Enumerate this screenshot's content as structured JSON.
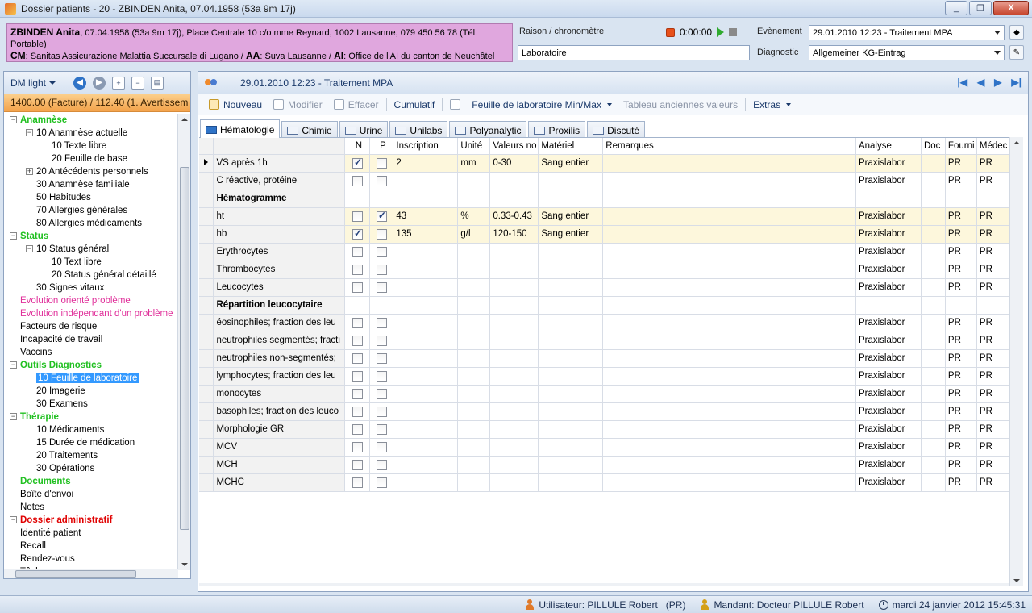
{
  "window": {
    "title": "Dossier patients - 20 - ZBINDEN Anita, 07.04.1958 (53a 9m 17j)",
    "controls": [
      "_",
      "❐",
      "X"
    ]
  },
  "patient": {
    "name": "ZBINDEN Anita",
    "details": ", 07.04.1958 (53a 9m 17j), Place Centrale 10 c/o mme Reynard, 1002 Lausanne, 079 450 56 78 (Tél. Portable)",
    "cm_label": "CM",
    "cm_value": ": Sanitas Assicurazione Malattia Succursale di Lugano / ",
    "aa_label": "AA",
    "aa_value": ": Suva Lausanne / ",
    "ai_label": "AI",
    "ai_value": ": Office de l'AI du canton de Neuchâtel"
  },
  "header": {
    "raison_label": "Raison / chronomètre",
    "raison_value": "Laboratoire",
    "timer": "0:00:00",
    "evenement_label": "Evènement",
    "evenement_value": "29.01.2010 12:23 - Traitement MPA",
    "diagnostic_label": "Diagnostic",
    "diagnostic_value": "Allgemeiner KG-Eintrag"
  },
  "left": {
    "view_selector": "DM light",
    "facture": "1400.00 (Facture) / 112.40 (1. Avertissem",
    "tree": [
      {
        "label": "Anamnèse",
        "level": 0,
        "style": "green",
        "exp": "−"
      },
      {
        "label": "10 Anamnèse actuelle",
        "level": 1,
        "exp": "−"
      },
      {
        "label": "10 Texte libre",
        "level": 2
      },
      {
        "label": "20 Feuille de base",
        "level": 2
      },
      {
        "label": "20 Antécédents personnels",
        "level": 1,
        "exp": "+"
      },
      {
        "label": "30 Anamnèse familiale",
        "level": 1
      },
      {
        "label": "50 Habitudes",
        "level": 1
      },
      {
        "label": "70 Allergies générales",
        "level": 1
      },
      {
        "label": "80 Allergies médicaments",
        "level": 1
      },
      {
        "label": "Status",
        "level": 0,
        "style": "green",
        "exp": "−"
      },
      {
        "label": "10 Status général",
        "level": 1,
        "exp": "−"
      },
      {
        "label": "10 Text libre",
        "level": 2
      },
      {
        "label": "20 Status général détaillé",
        "level": 2
      },
      {
        "label": "30 Signes vitaux",
        "level": 1
      },
      {
        "label": "Evolution orienté problème",
        "level": 0,
        "style": "pink"
      },
      {
        "label": "Evolution indépendant d'un problème",
        "level": 0,
        "style": "pink"
      },
      {
        "label": "Facteurs de risque",
        "level": 0
      },
      {
        "label": "Incapacité de travail",
        "level": 0
      },
      {
        "label": "Vaccins",
        "level": 0
      },
      {
        "label": "Outils Diagnostics",
        "level": 0,
        "style": "green",
        "exp": "−"
      },
      {
        "label": "10 Feuille de laboratoire",
        "level": 1,
        "selected": true
      },
      {
        "label": "20 Imagerie",
        "level": 1
      },
      {
        "label": "30 Examens",
        "level": 1
      },
      {
        "label": "Thérapie",
        "level": 0,
        "style": "green",
        "exp": "−"
      },
      {
        "label": "10 Médicaments",
        "level": 1
      },
      {
        "label": "15 Durée de médication",
        "level": 1
      },
      {
        "label": "20 Traitements",
        "level": 1
      },
      {
        "label": "30 Opérations",
        "level": 1
      },
      {
        "label": "Documents",
        "level": 0,
        "style": "green"
      },
      {
        "label": "Boîte d'envoi",
        "level": 0
      },
      {
        "label": "Notes",
        "level": 0
      },
      {
        "label": "Dossier administratif",
        "level": 0,
        "style": "red",
        "exp": "−"
      },
      {
        "label": "Identité patient",
        "level": 0
      },
      {
        "label": "Recall",
        "level": 0
      },
      {
        "label": "Rendez-vous",
        "level": 0
      },
      {
        "label": "Tâches",
        "level": 0
      }
    ]
  },
  "main": {
    "event_title": "29.01.2010 12:23 - Traitement MPA",
    "pager": [
      "|◀",
      "◀",
      "▶",
      "▶|"
    ],
    "toolbar": {
      "nouveau": "Nouveau",
      "modifier": "Modifier",
      "effacer": "Effacer",
      "cumulatif": "Cumulatif",
      "feuille": "Feuille de laboratoire Min/Max",
      "tableau": "Tableau anciennes valeurs",
      "extras": "Extras"
    },
    "tabs": [
      "Hématologie",
      "Chimie",
      "Urine",
      "Unilabs",
      "Polyanalytic",
      "Proxilis",
      "Discuté"
    ],
    "columns": [
      "",
      "",
      "N",
      "P",
      "Inscription",
      "Unité",
      "Valeurs no",
      "Matériel",
      "Remarques",
      "Analyse",
      "Doc",
      "Fourni",
      "Médec"
    ],
    "rows": [
      {
        "name": "VS après 1h",
        "n": true,
        "p": false,
        "inscription": "2",
        "unite": "mm",
        "valeurs": "0-30",
        "materiel": "Sang entier",
        "analyse": "Praxislabor",
        "fourni": "PR",
        "medec": "PR",
        "filled": true,
        "current": true
      },
      {
        "name": "C réactive, protéine",
        "n": false,
        "p": false,
        "analyse": "Praxislabor",
        "fourni": "PR",
        "medec": "PR"
      },
      {
        "name": "Hématogramme",
        "group": true
      },
      {
        "name": "ht",
        "n": false,
        "p": true,
        "inscription": "43",
        "unite": "%",
        "valeurs": "0.33-0.43",
        "materiel": "Sang entier",
        "analyse": "Praxislabor",
        "fourni": "PR",
        "medec": "PR",
        "filled": true
      },
      {
        "name": "hb",
        "n": true,
        "p": false,
        "inscription": "135",
        "unite": "g/l",
        "valeurs": "120-150",
        "materiel": "Sang entier",
        "analyse": "Praxislabor",
        "fourni": "PR",
        "medec": "PR",
        "filled": true
      },
      {
        "name": "Erythrocytes",
        "n": false,
        "p": false,
        "analyse": "Praxislabor",
        "fourni": "PR",
        "medec": "PR"
      },
      {
        "name": "Thrombocytes",
        "n": false,
        "p": false,
        "analyse": "Praxislabor",
        "fourni": "PR",
        "medec": "PR"
      },
      {
        "name": "Leucocytes",
        "n": false,
        "p": false,
        "analyse": "Praxislabor",
        "fourni": "PR",
        "medec": "PR"
      },
      {
        "name": "Répartition leucocytaire",
        "group": true
      },
      {
        "name": "éosinophiles; fraction des leu",
        "n": false,
        "p": false,
        "analyse": "Praxislabor",
        "fourni": "PR",
        "medec": "PR"
      },
      {
        "name": "neutrophiles segmentés; fracti",
        "n": false,
        "p": false,
        "analyse": "Praxislabor",
        "fourni": "PR",
        "medec": "PR"
      },
      {
        "name": "neutrophiles non-segmentés;",
        "n": false,
        "p": false,
        "analyse": "Praxislabor",
        "fourni": "PR",
        "medec": "PR"
      },
      {
        "name": "lymphocytes; fraction des leu",
        "n": false,
        "p": false,
        "analyse": "Praxislabor",
        "fourni": "PR",
        "medec": "PR"
      },
      {
        "name": "monocytes",
        "n": false,
        "p": false,
        "analyse": "Praxislabor",
        "fourni": "PR",
        "medec": "PR"
      },
      {
        "name": "basophiles; fraction des leuco",
        "n": false,
        "p": false,
        "analyse": "Praxislabor",
        "fourni": "PR",
        "medec": "PR"
      },
      {
        "name": "Morphologie GR",
        "n": false,
        "p": false,
        "analyse": "Praxislabor",
        "fourni": "PR",
        "medec": "PR"
      },
      {
        "name": "MCV",
        "n": false,
        "p": false,
        "analyse": "Praxislabor",
        "fourni": "PR",
        "medec": "PR"
      },
      {
        "name": "MCH",
        "n": false,
        "p": false,
        "analyse": "Praxislabor",
        "fourni": "PR",
        "medec": "PR"
      },
      {
        "name": "MCHC",
        "n": false,
        "p": false,
        "analyse": "Praxislabor",
        "fourni": "PR",
        "medec": "PR"
      }
    ]
  },
  "status": {
    "utilisateur": "Utilisateur: PILLULE Robert   (PR)",
    "mandant": "Mandant: Docteur PILLULE Robert",
    "datetime": "mardi 24 janvier 2012 15:45:31"
  },
  "colors": {
    "patient_bg": "#e0a7de",
    "facture_bg": "#f3a24a",
    "tree_green": "#21c021",
    "tree_pink": "#e0309a",
    "tree_red": "#e00000",
    "selected": "#3399ff",
    "filled_row": "#fdf7dc"
  }
}
